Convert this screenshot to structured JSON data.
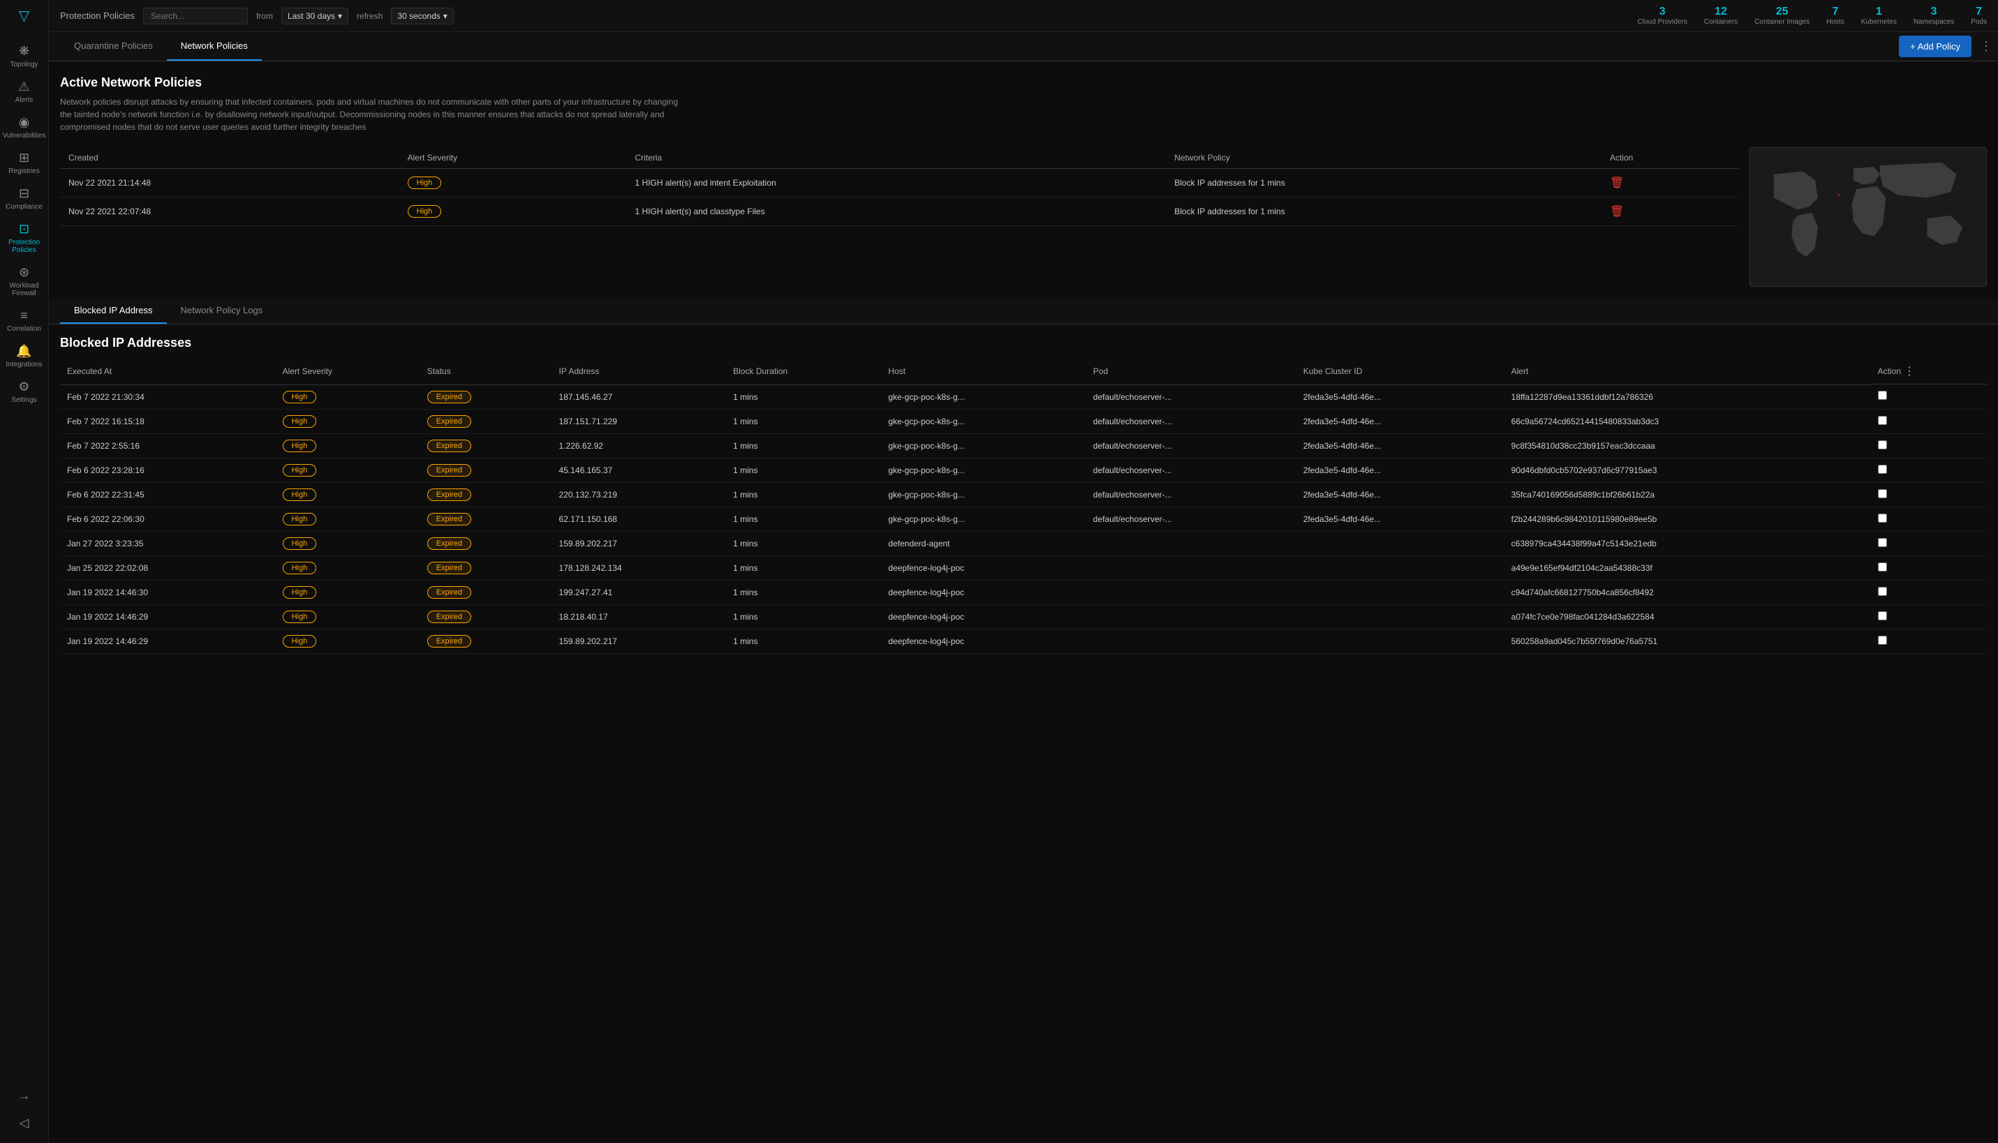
{
  "sidebar": {
    "logo": "▽",
    "items": [
      {
        "id": "topology",
        "label": "Topology",
        "icon": "❋",
        "active": false
      },
      {
        "id": "alerts",
        "label": "Alerts",
        "icon": "⚠",
        "active": false
      },
      {
        "id": "vulnerabilities",
        "label": "Vulnerabilities",
        "icon": "◉",
        "active": false
      },
      {
        "id": "registries",
        "label": "Registries",
        "icon": "⊞",
        "active": false
      },
      {
        "id": "compliance",
        "label": "Compliance",
        "icon": "⊟",
        "active": false
      },
      {
        "id": "protection",
        "label": "Protection Policies",
        "icon": "⊡",
        "active": true
      },
      {
        "id": "workload",
        "label": "Workload Firewall",
        "icon": "⊛",
        "active": false
      },
      {
        "id": "correlation",
        "label": "Correlation",
        "icon": "≡",
        "active": false
      },
      {
        "id": "integrations",
        "label": "Integrations",
        "icon": "🔔",
        "active": false
      },
      {
        "id": "settings",
        "label": "Settings",
        "icon": "⚙",
        "active": false
      }
    ],
    "bottom_items": [
      {
        "id": "export",
        "icon": "→",
        "label": ""
      },
      {
        "id": "collapse",
        "icon": "◁",
        "label": ""
      }
    ]
  },
  "topbar": {
    "title": "Protection Policies",
    "search_placeholder": "Search...",
    "from_label": "from",
    "date_range": "Last 30 days",
    "refresh_label": "refresh",
    "refresh_interval": "30 seconds",
    "stats": [
      {
        "id": "cloud-providers",
        "num": "3",
        "label": "Cloud Providers"
      },
      {
        "id": "containers",
        "num": "12",
        "label": "Containers"
      },
      {
        "id": "container-images",
        "num": "25",
        "label": "Container Images"
      },
      {
        "id": "hosts",
        "num": "7",
        "label": "Hosts"
      },
      {
        "id": "kubernetes",
        "num": "1",
        "label": "Kubernetes"
      },
      {
        "id": "namespaces",
        "num": "3",
        "label": "Namespaces"
      },
      {
        "id": "pods",
        "num": "7",
        "label": "Pods"
      }
    ]
  },
  "main_tabs": [
    {
      "id": "quarantine",
      "label": "Quarantine Policies",
      "active": false
    },
    {
      "id": "network",
      "label": "Network Policies",
      "active": true
    }
  ],
  "add_policy_label": "+ Add Policy",
  "active_network_policies": {
    "title": "Active Network Policies",
    "description": "Network policies disrupt attacks by ensuring that infected containers, pods and virtual machines do not communicate with other parts of your infrastructure by changing the tainted node's network function i.e. by disallowing network input/output. Decommissioning nodes in this manner ensures that attacks do not spread laterally and compromised nodes that do not serve user queries avoid further integrity breaches",
    "columns": [
      "Created",
      "Alert Severity",
      "Criteria",
      "Network Policy",
      "Action"
    ],
    "rows": [
      {
        "created": "Nov 22 2021 21:14:48",
        "severity": "High",
        "criteria": "1 HIGH alert(s) and intent Exploitation",
        "network_policy": "Block IP addresses for 1 mins",
        "action": "delete"
      },
      {
        "created": "Nov 22 2021 22:07:48",
        "severity": "High",
        "criteria": "1 HIGH alert(s) and classtype Files",
        "network_policy": "Block IP addresses for 1 mins",
        "action": "delete"
      }
    ]
  },
  "sub_tabs": [
    {
      "id": "blocked-ip",
      "label": "Blocked IP Address",
      "active": true
    },
    {
      "id": "network-logs",
      "label": "Network Policy Logs",
      "active": false
    }
  ],
  "blocked_ip": {
    "title": "Blocked IP Addresses",
    "columns": [
      "Executed At",
      "Alert Severity",
      "Status",
      "IP Address",
      "Block Duration",
      "Host",
      "Pod",
      "Kube Cluster ID",
      "Alert",
      "Action"
    ],
    "rows": [
      {
        "executed_at": "Feb 7 2022 21:30:34",
        "severity": "High",
        "status": "Expired",
        "ip": "187.145.46.27",
        "duration": "1 mins",
        "host": "gke-gcp-poc-k8s-g...",
        "pod": "default/echoserver-...",
        "kube_cluster": "2feda3e5-4dfd-46e...",
        "alert": "18ffa12287d9ea13361ddbf12a786326",
        "checked": false
      },
      {
        "executed_at": "Feb 7 2022 16:15:18",
        "severity": "High",
        "status": "Expired",
        "ip": "187.151.71.229",
        "duration": "1 mins",
        "host": "gke-gcp-poc-k8s-g...",
        "pod": "default/echoserver-...",
        "kube_cluster": "2feda3e5-4dfd-46e...",
        "alert": "66c9a56724cd65214415480833ab3dc3",
        "checked": false
      },
      {
        "executed_at": "Feb 7 2022 2:55:16",
        "severity": "High",
        "status": "Expired",
        "ip": "1.226.62.92",
        "duration": "1 mins",
        "host": "gke-gcp-poc-k8s-g...",
        "pod": "default/echoserver-...",
        "kube_cluster": "2feda3e5-4dfd-46e...",
        "alert": "9c8f354810d38cc23b9157eac3dccaaa",
        "checked": false
      },
      {
        "executed_at": "Feb 6 2022 23:28:16",
        "severity": "High",
        "status": "Expired",
        "ip": "45.146.165.37",
        "duration": "1 mins",
        "host": "gke-gcp-poc-k8s-g...",
        "pod": "default/echoserver-...",
        "kube_cluster": "2feda3e5-4dfd-46e...",
        "alert": "90d46dbfd0cb5702e937d6c977915ae3",
        "checked": false
      },
      {
        "executed_at": "Feb 6 2022 22:31:45",
        "severity": "High",
        "status": "Expired",
        "ip": "220.132.73.219",
        "duration": "1 mins",
        "host": "gke-gcp-poc-k8s-g...",
        "pod": "default/echoserver-...",
        "kube_cluster": "2feda3e5-4dfd-46e...",
        "alert": "35fca740169056d5889c1bf26b61b22a",
        "checked": false
      },
      {
        "executed_at": "Feb 6 2022 22:06:30",
        "severity": "High",
        "status": "Expired",
        "ip": "62.171.150.168",
        "duration": "1 mins",
        "host": "gke-gcp-poc-k8s-g...",
        "pod": "default/echoserver-...",
        "kube_cluster": "2feda3e5-4dfd-46e...",
        "alert": "f2b244289b6c9842010115980e89ee5b",
        "checked": false
      },
      {
        "executed_at": "Jan 27 2022 3:23:35",
        "severity": "High",
        "status": "Expired",
        "ip": "159.89.202.217",
        "duration": "1 mins",
        "host": "defenderd-agent",
        "pod": "",
        "kube_cluster": "",
        "alert": "c638979ca434438f99a47c5143e21edb",
        "checked": false
      },
      {
        "executed_at": "Jan 25 2022 22:02:08",
        "severity": "High",
        "status": "Expired",
        "ip": "178.128.242.134",
        "duration": "1 mins",
        "host": "deepfence-log4j-poc",
        "pod": "",
        "kube_cluster": "",
        "alert": "a49e9e165ef94df2104c2aa54388c33f",
        "checked": false
      },
      {
        "executed_at": "Jan 19 2022 14:46:30",
        "severity": "High",
        "status": "Expired",
        "ip": "199.247.27.41",
        "duration": "1 mins",
        "host": "deepfence-log4j-poc",
        "pod": "",
        "kube_cluster": "",
        "alert": "c94d740afc668127750b4ca856cf8492",
        "checked": false
      },
      {
        "executed_at": "Jan 19 2022 14:46:29",
        "severity": "High",
        "status": "Expired",
        "ip": "18.218.40.17",
        "duration": "1 mins",
        "host": "deepfence-log4j-poc",
        "pod": "",
        "kube_cluster": "",
        "alert": "a074fc7ce0e798fac041284d3a622584",
        "checked": false
      },
      {
        "executed_at": "Jan 19 2022 14:46:29",
        "severity": "High",
        "status": "Expired",
        "ip": "159.89.202.217",
        "duration": "1 mins",
        "host": "deepfence-log4j-poc",
        "pod": "",
        "kube_cluster": "",
        "alert": "560258a9ad045c7b55f769d0e76a5751",
        "checked": false
      }
    ]
  },
  "colors": {
    "accent": "#00bcd4",
    "high_badge": "orange",
    "expired_badge": "orange",
    "delete": "#e53935",
    "active_tab": "#2196f3",
    "bg_main": "#111",
    "bg_body": "#0d0d0d"
  }
}
